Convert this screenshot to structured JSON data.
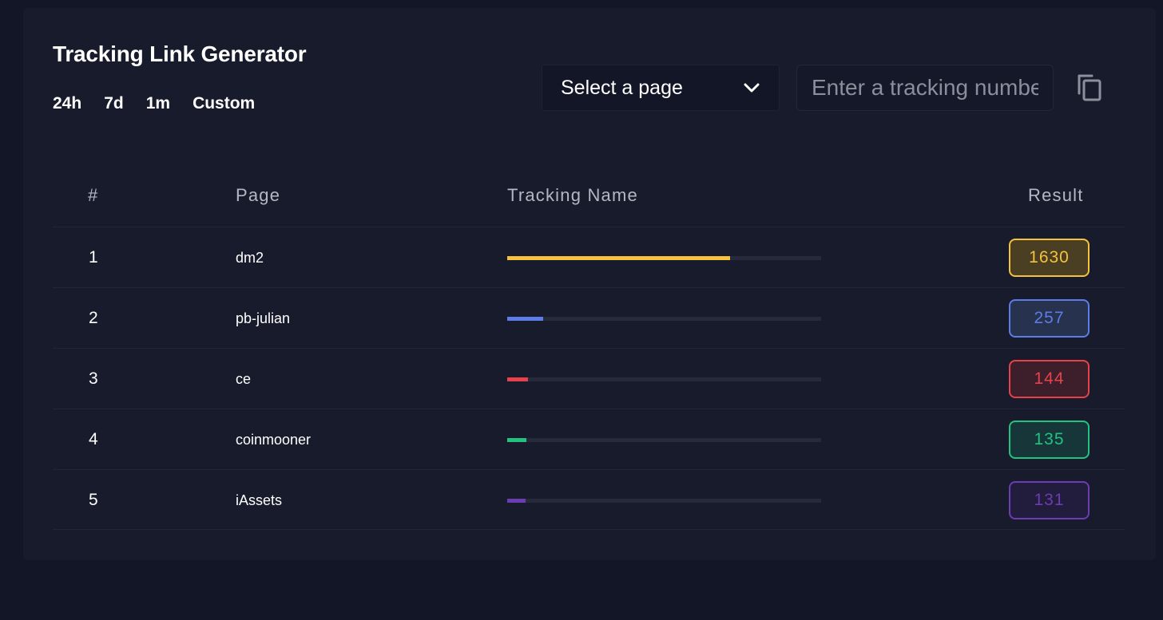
{
  "header": {
    "title": "Tracking Link Generator",
    "ranges": [
      "24h",
      "7d",
      "1m",
      "Custom"
    ]
  },
  "controls": {
    "select_label": "Select a page",
    "tracking_placeholder": "Enter a tracking number",
    "icons": {
      "select": "chevron-down-icon",
      "copy": "copy-icon"
    }
  },
  "table": {
    "columns": [
      "#",
      "Page",
      "Tracking Name",
      "Result"
    ],
    "rows": [
      {
        "rank": "1",
        "page": "dm2",
        "result": "1630",
        "progress": 0.71,
        "color": "#f4c23d",
        "badge_bg": "#4a3f23"
      },
      {
        "rank": "2",
        "page": "pb-julian",
        "result": "257",
        "progress": 0.115,
        "color": "#5d7ce8",
        "badge_bg": "#27324f"
      },
      {
        "rank": "3",
        "page": "ce",
        "result": "144",
        "progress": 0.065,
        "color": "#e8414a",
        "badge_bg": "#3c1f2a"
      },
      {
        "rank": "4",
        "page": "coinmooner",
        "result": "135",
        "progress": 0.06,
        "color": "#22c37f",
        "badge_bg": "#17363a"
      },
      {
        "rank": "5",
        "page": "iAssets",
        "result": "131",
        "progress": 0.058,
        "color": "#6c3cb3",
        "badge_bg": "#221d3c"
      }
    ]
  }
}
